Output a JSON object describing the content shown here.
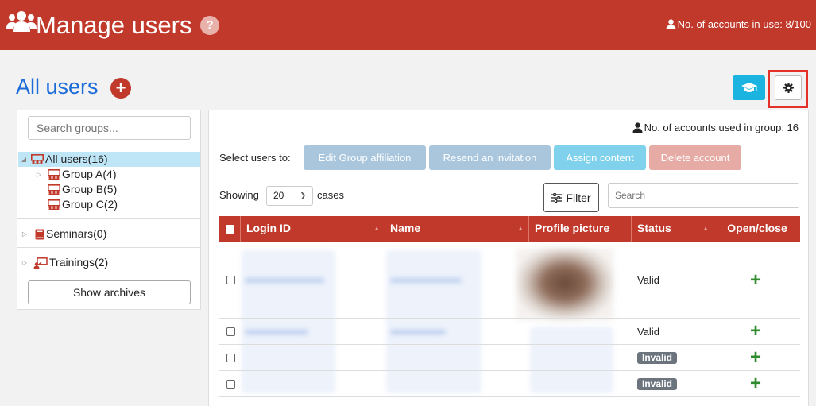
{
  "header": {
    "title": "Manage users",
    "help": "?",
    "accounts_in_use": "No. of accounts in use: 8/100"
  },
  "page": {
    "title": "All users"
  },
  "sidebar": {
    "search_placeholder": "Search groups...",
    "tree": [
      {
        "label": "All users(16)"
      },
      {
        "label": "Group A(4)"
      },
      {
        "label": "Group B(5)"
      },
      {
        "label": "Group C(2)"
      }
    ],
    "seminars": "Seminars(0)",
    "trainings": "Trainings(2)",
    "show_archives": "Show archives"
  },
  "main": {
    "group_accounts": "No. of accounts used in group: 16",
    "select_users_label": "Select users to:",
    "actions": [
      {
        "label": "Edit Group affiliation",
        "color": "#a9c6dd"
      },
      {
        "label": "Resend an invitation",
        "color": "#a9c6dd"
      },
      {
        "label": "Assign content",
        "color": "#80d2ec"
      },
      {
        "label": "Delete account",
        "color": "#e7aba6"
      }
    ],
    "showing_label": "Showing",
    "page_size": "20",
    "cases_label": "cases",
    "filter_label": "Filter",
    "search_placeholder": "Search"
  },
  "table": {
    "columns": [
      "Login ID",
      "Name",
      "Profile picture",
      "Status",
      "Open/close"
    ],
    "rows": [
      {
        "status": "Valid"
      },
      {
        "status": "Valid"
      },
      {
        "status": "Invalid"
      },
      {
        "status": "Invalid"
      }
    ],
    "expand_symbol": "+"
  },
  "colors": {
    "header": "#c0392b",
    "title_blue": "#1b6bd8",
    "accent_cyan": "#1bb3e0",
    "highlight_box": "#e5302a"
  }
}
